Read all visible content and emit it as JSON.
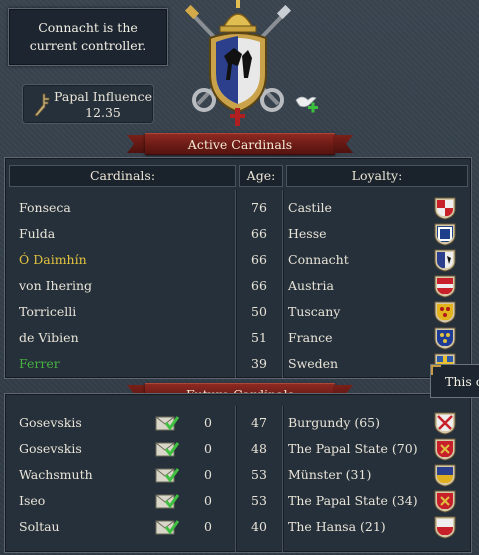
{
  "controller": {
    "text": "Connacht is the current controller."
  },
  "influence": {
    "label": "Papal Influence",
    "value": "12.35"
  },
  "active": {
    "title": "Active Cardinals",
    "headers": {
      "cardinals": "Cardinals:",
      "age": "Age:",
      "loyalty": "Loyalty:"
    },
    "rows": [
      {
        "name": "Fonseca",
        "age": "76",
        "loyalty": "Castile",
        "color": "#e8e4d8",
        "shield": "castile"
      },
      {
        "name": "Fulda",
        "age": "66",
        "loyalty": "Hesse",
        "color": "#e8e4d8",
        "shield": "hesse"
      },
      {
        "name": "Ó Daimhín",
        "age": "66",
        "loyalty": "Connacht",
        "color": "#e1c33e",
        "shield": "connacht"
      },
      {
        "name": "von Ihering",
        "age": "66",
        "loyalty": "Austria",
        "color": "#e8e4d8",
        "shield": "austria"
      },
      {
        "name": "Torricelli",
        "age": "50",
        "loyalty": "Tuscany",
        "color": "#e8e4d8",
        "shield": "tuscany"
      },
      {
        "name": "de Vibien",
        "age": "51",
        "loyalty": "France",
        "color": "#e8e4d8",
        "shield": "france"
      },
      {
        "name": "Ferrer",
        "age": "39",
        "loyalty": "Sweden",
        "color": "#47b13f",
        "shield": "sweden"
      }
    ]
  },
  "future": {
    "title": "Future Cardinals",
    "rows": [
      {
        "name": "Gosevskis",
        "invites": "0",
        "age": "47",
        "loyalty": "Burgundy (65)",
        "shield": "burgundy"
      },
      {
        "name": "Gosevskis",
        "invites": "0",
        "age": "48",
        "loyalty": "The Papal State (70)",
        "shield": "papal"
      },
      {
        "name": "Wachsmuth",
        "invites": "0",
        "age": "53",
        "loyalty": "Münster (31)",
        "shield": "munster"
      },
      {
        "name": "Iseo",
        "invites": "0",
        "age": "53",
        "loyalty": "The Papal State (34)",
        "shield": "papal"
      },
      {
        "name": "Soltau",
        "invites": "0",
        "age": "40",
        "loyalty": "The Hansa (21)",
        "shield": "hansa"
      }
    ]
  },
  "tooltip": {
    "text": "This c"
  },
  "icons": {
    "crest": "papal-crest-icon",
    "dove": "dove-add-icon",
    "cross": "papal-cross-icon",
    "invite": "envelope-check-icon"
  }
}
